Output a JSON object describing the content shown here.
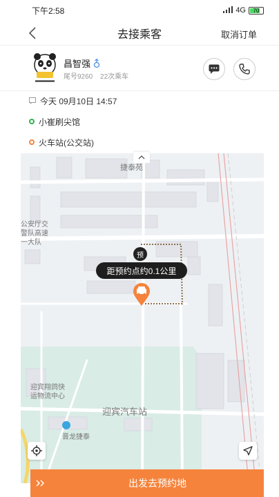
{
  "status_bar": {
    "time": "下午2:58",
    "network": "4G",
    "battery": "70"
  },
  "nav": {
    "title": "去接乘客",
    "cancel_label": "取消订单"
  },
  "passenger": {
    "name": "昌智强",
    "tail_number": "尾号9260",
    "ride_count": "22次乘车",
    "gender_color": "#4a90e2"
  },
  "trip": {
    "time": "今天 09月10日 14:57",
    "pickup": "小崔刷尖馆",
    "pickup_color": "#2fb34a",
    "dropoff": "火车站(公交站)",
    "dropoff_color": "#f5833b"
  },
  "map": {
    "labels": {
      "jietai_yuan": "捷泰苑",
      "gonganting": "公安厅交",
      "gaosu_line1": "警队高速",
      "gaosu_line2": "一大队",
      "yingbin_kuaiyun_line1": "迎宾翔鸽快",
      "yingbin_kuaiyun_line2": "运物流中心",
      "yingbin_station": "迎宾汽车站",
      "jinlong_jietai": "晋龙捷泰"
    },
    "pre_badge": "预",
    "distance_tooltip": "距预约点约0.1公里"
  },
  "bottom": {
    "action_label": "出发去预约地"
  },
  "colors": {
    "accent": "#f5833b",
    "tooltip_bg": "#1e1e1e"
  }
}
